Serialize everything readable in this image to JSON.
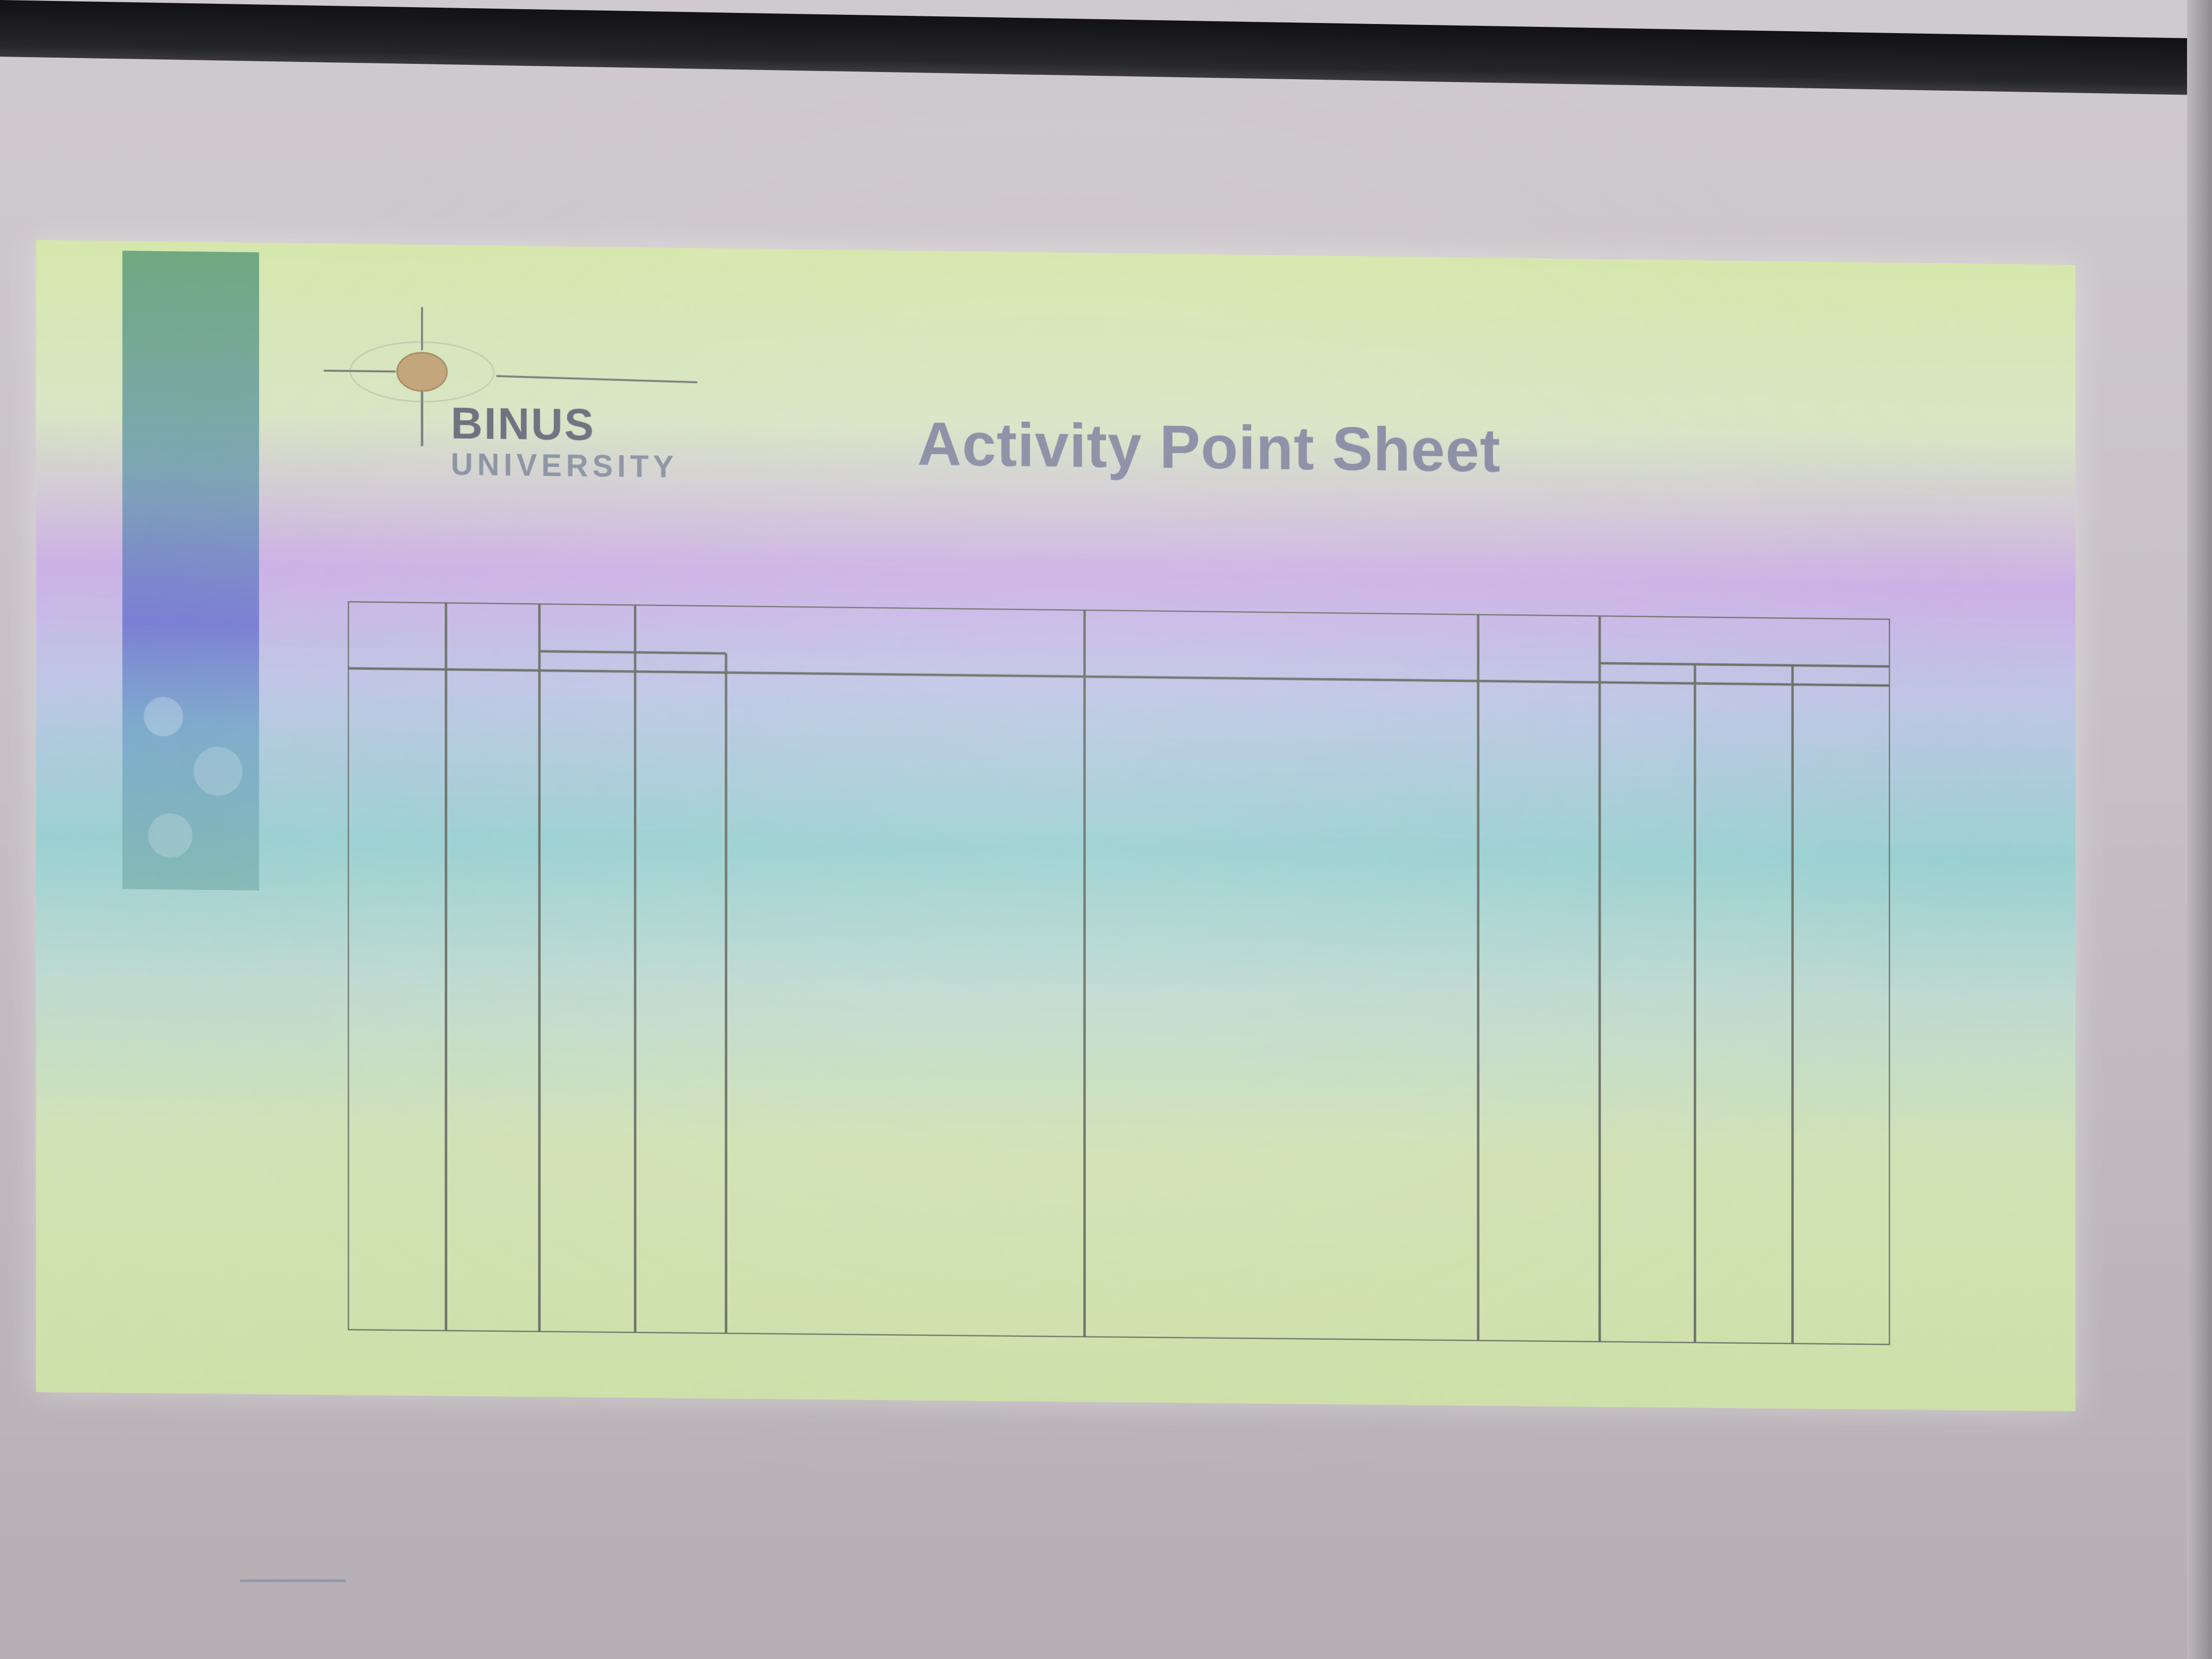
{
  "logo": {
    "name": "BINUS",
    "subtitle": "UNIVERSITY"
  },
  "slide": {
    "title": "Activity Point Sheet"
  },
  "colors": {
    "title": "#8a8ca4",
    "table_lines": "#6a6f66",
    "logo_orb": "#c3a57a"
  }
}
